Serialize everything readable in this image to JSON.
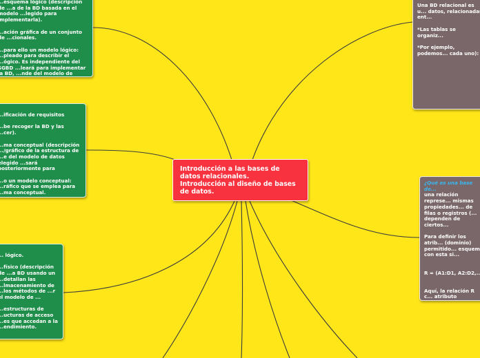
{
  "center": {
    "title": "Introducción a las bases de datos relacionales.\nIntroducción al diseño de bases de datos."
  },
  "left_nodes": [
    {
      "id": "logico",
      "text": "...esquema lógico (descripción de ...a de la BD basada en el modelo ...legido para implementarla).\n\n...ación gráfica de un conjunto de ...cionales.\n\n...para ello un modelo lógico: ...pleado para describir el ...ógico. Es independiente del SGBD ...leará para implementar la BD, ...nde del modelo de datos"
    },
    {
      "id": "requisitos",
      "text": "...ificación de requisitos\n\n...be recoger la BD y las ...cer).\n\n...ma conceptual (descripción .../gráfico de la estructura de ...e del modelo de datos elegido ...sará posteriormente para\n\n...o un modelo conceptual: ...ráfico que se emplea para ...ma conceptual."
    },
    {
      "id": "fisico",
      "text": "... lógico.\n\n...físico (descripción de ...a BD usando un ...detallan las ...lmacenamiento de ...los métodos de ...r el modelo de ...\n\n...estructuras de ...ucturas de acceso ...es que accedan a la ...endimiento."
    }
  ],
  "right_nodes": [
    {
      "id": "bd-relacional",
      "text": "Una BD relacional es u... datos, relacionadas ent...\n\n*Las tablas se organiz...\n\n*Por ejemplo, podemos... cada uno):"
    },
    {
      "id": "que-es",
      "link_text": "¿Qué es una base de...",
      "text": "una relación represe... mismas propiedades... de filas o registros (... dependen de ciertos...\n\nPara definir los atrib... (dominio) permitido... esquema con esta si...\n\n\nR = (A1:D1, A2:D2,...\n\n\nAquí, la relación R c... atributo correspondie... etc.)."
    }
  ],
  "colors": {
    "background": "#FFE619",
    "center": "#F8323F",
    "green_node": "#1E8E4A",
    "grey_node": "#7A6769",
    "link_line": "#3A3A3A",
    "hyperlink": "#39B8F0"
  }
}
